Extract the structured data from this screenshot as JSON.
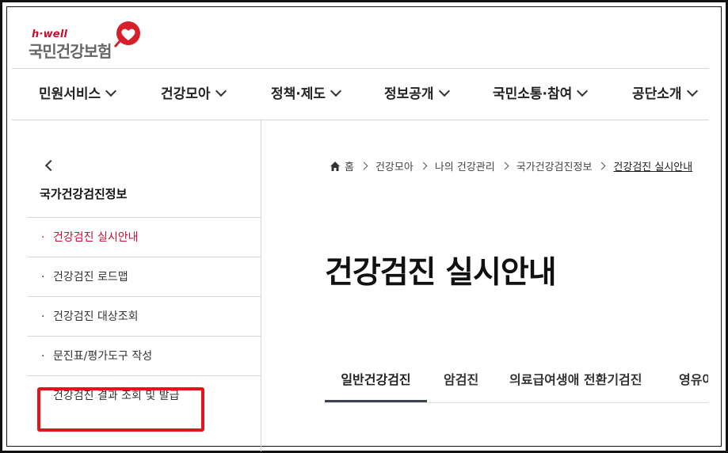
{
  "logo": {
    "small": "h·well",
    "big": "국민건강보험"
  },
  "gnb": [
    {
      "label": "민원서비스"
    },
    {
      "label": "건강모아"
    },
    {
      "label": "정책·제도"
    },
    {
      "label": "정보공개"
    },
    {
      "label": "국민소통·참여"
    },
    {
      "label": "공단소개"
    }
  ],
  "lnb": {
    "title": "국가건강검진정보",
    "bullet": "·",
    "items": [
      {
        "label": "건강검진 실시안내",
        "active": true
      },
      {
        "label": "건강검진 로드맵"
      },
      {
        "label": "건강검진 대상조회"
      },
      {
        "label": "문진표/평가도구 작성"
      },
      {
        "label": "건강검진 결과 조회 및 발급"
      }
    ]
  },
  "breadcrumb": {
    "home": "홈",
    "items": [
      "건강모아",
      "나의 건강관리",
      "국가건강검진정보",
      "건강검진 실시안내"
    ]
  },
  "page_title": "건강검진 실시안내",
  "tabs": [
    {
      "label": "일반건강검진",
      "active": true
    },
    {
      "label": "암검진"
    },
    {
      "label": "의료급여생애 전환기검진"
    },
    {
      "label": "영유아"
    }
  ],
  "colors": {
    "brand_red": "#c8102e",
    "highlight_red": "#e8121b",
    "tab_bar": "#3a4451"
  }
}
